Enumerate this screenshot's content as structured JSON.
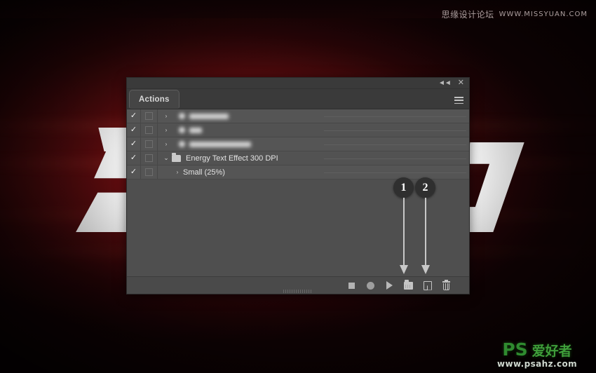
{
  "watermarks": {
    "top_cn": "思缘设计论坛",
    "top_url": "WWW.MISSYUAN.COM",
    "bottom_ps": "PS",
    "bottom_cn": "爱好者",
    "bottom_url": "www.psahz.com"
  },
  "panel": {
    "tab_label": "Actions",
    "titlebar": {
      "collapse_icon": "double-chevron-left",
      "close_icon": "close-x",
      "menu_icon": "hamburger-menu"
    },
    "rows": [
      {
        "checked": "✓",
        "dialog": "",
        "label": "",
        "blurred": true,
        "blur_width": 56,
        "indent": 0,
        "twisty": "",
        "has_folder": true
      },
      {
        "checked": "✓",
        "dialog": "",
        "label": "",
        "blurred": true,
        "blur_width": 18,
        "indent": 0,
        "twisty": "",
        "has_folder": true
      },
      {
        "checked": "✓",
        "dialog": "",
        "label": "",
        "blurred": true,
        "blur_width": 88,
        "indent": 0,
        "twisty": "",
        "has_folder": true
      },
      {
        "checked": "✓",
        "dialog": "",
        "label": "Energy Text Effect 300 DPI",
        "blurred": false,
        "indent": 0,
        "twisty": "⌄",
        "has_folder": true
      },
      {
        "checked": "✓",
        "dialog": "",
        "label": "Small (25%)",
        "blurred": false,
        "indent": 1,
        "twisty": "›",
        "has_folder": false
      }
    ],
    "toolbar": [
      {
        "name": "stop-button",
        "label": "Stop"
      },
      {
        "name": "record-button",
        "label": "Begin recording"
      },
      {
        "name": "play-button",
        "label": "Play selection"
      },
      {
        "name": "new-set-button",
        "label": "Create new set"
      },
      {
        "name": "new-action-button",
        "label": "Create new action"
      },
      {
        "name": "delete-button",
        "label": "Delete"
      }
    ]
  },
  "callouts": [
    {
      "number": "1",
      "target": "new-set-button"
    },
    {
      "number": "2",
      "target": "new-action-button"
    }
  ],
  "colors": {
    "panel_bg": "#4f4f4f",
    "panel_header": "#3a3a3a",
    "accent_red": "#8b1113",
    "callout_bg": "#2f2f2f",
    "wm_green": "#2f8b2f"
  }
}
